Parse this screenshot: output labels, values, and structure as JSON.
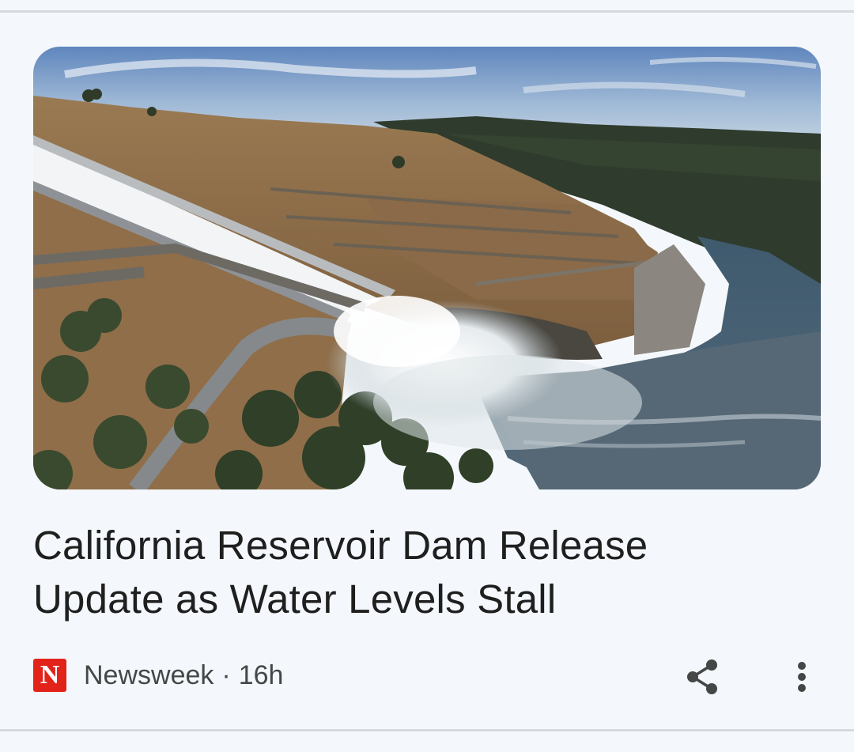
{
  "article": {
    "headline": "California Reservoir Dam Release Update as Water Levels Stall",
    "image_subject": "Aerial view of a dam spillway releasing water into a river",
    "source": {
      "logo_letter": "N",
      "name": "Newsweek",
      "separator": "·",
      "age": "16h"
    },
    "actions": {
      "share_icon": "share-icon",
      "more_icon": "more-vert-icon"
    }
  },
  "colors": {
    "background": "#f4f8fc",
    "divider": "#d6dadf",
    "headline": "#1f1f1f",
    "meta_text": "#444746",
    "newsweek_red": "#e2231a",
    "icon": "#444746"
  }
}
